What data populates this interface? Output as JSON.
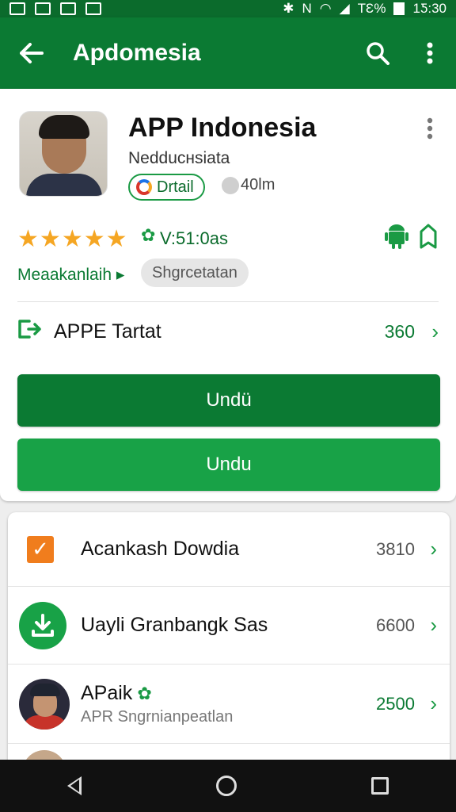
{
  "status_bar": {
    "battery": "TԐ%",
    "time": "1Ƽ:30"
  },
  "app_bar": {
    "title": "Apdomesia",
    "back_icon": "arrow-back-icon",
    "search_icon": "search-icon",
    "more_icon": "more-vert-icon"
  },
  "app": {
    "name": "APP Indonesia",
    "developer": "Nedduснsiata",
    "detail_label": "Drtail",
    "size_label": "40lm",
    "rating_stars": 5,
    "rating_text": "V:51:0as",
    "more_link": "Meaakanlaih",
    "tag_chip": "Shgrcetatan",
    "stat_label": "APPE Tartat",
    "stat_value": "360",
    "button_primary": "Undü",
    "button_secondary": "Undu"
  },
  "list": [
    {
      "title": "Acankash Dowdia",
      "value": "3810"
    },
    {
      "title": "Uayli Granbangk Sas",
      "value": "6600"
    },
    {
      "title": "APaik",
      "subtitle": "APR Sngrnianpeatlan",
      "value": "2500"
    }
  ],
  "colors": {
    "primary": "#0b7a33",
    "accent": "#18a247",
    "star": "#f5a623",
    "checkbox": "#f07d1d"
  }
}
